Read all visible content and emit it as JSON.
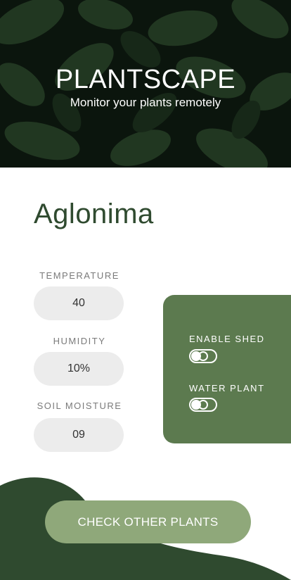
{
  "app": {
    "title": "PLANTSCAPE",
    "subtitle": "Monitor your plants remotely"
  },
  "plant": {
    "name": "Aglonima"
  },
  "stats": [
    {
      "label": "TEMPERATURE",
      "value": "40"
    },
    {
      "label": "HUMIDITY",
      "value": "10%"
    },
    {
      "label": "SOIL MOISTURE",
      "value": "09"
    }
  ],
  "controls": {
    "enable_shed": {
      "label": "ENABLE SHED",
      "on": false
    },
    "water_plant": {
      "label": "WATER PLANT",
      "on": false
    }
  },
  "cta": {
    "label": "CHECK OTHER PLANTS"
  },
  "colors": {
    "primary_dark": "#2f4a2f",
    "panel_green": "#5c7a4f",
    "cta_green": "#8fa87a",
    "pill_bg": "#ececec"
  }
}
